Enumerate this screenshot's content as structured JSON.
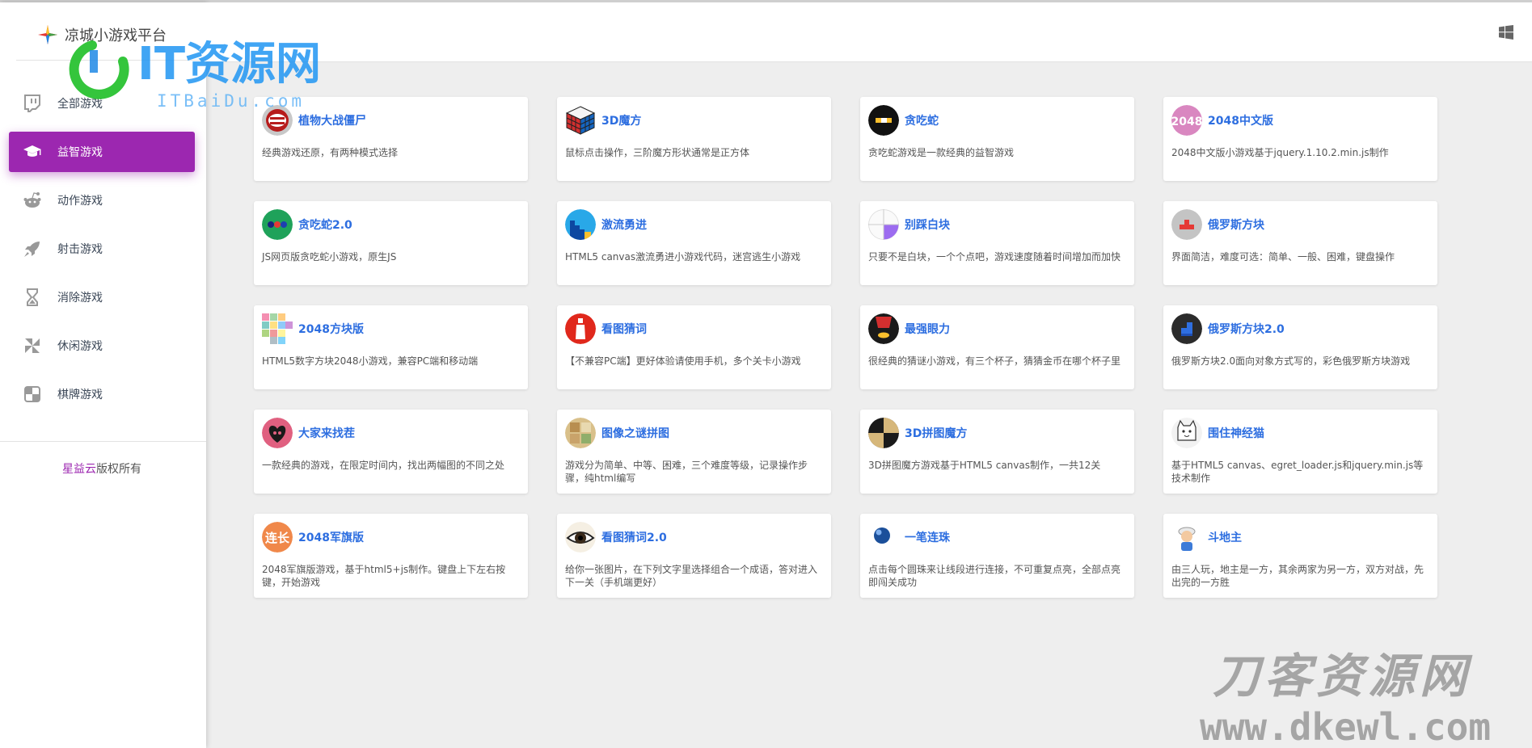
{
  "brand": {
    "title": "凉城小游戏平台"
  },
  "sidebar": {
    "items": [
      {
        "label": "全部游戏",
        "icon": "twitch-icon"
      },
      {
        "label": "益智游戏",
        "icon": "graduation-cap-icon",
        "active": true
      },
      {
        "label": "动作游戏",
        "icon": "reddit-icon"
      },
      {
        "label": "射击游戏",
        "icon": "rocket-icon"
      },
      {
        "label": "消除游戏",
        "icon": "hourglass-icon"
      },
      {
        "label": "休闲游戏",
        "icon": "pinwheel-icon"
      },
      {
        "label": "棋牌游戏",
        "icon": "checker-icon"
      }
    ],
    "copyright_link": "星益云",
    "copyright_text": "版权所有"
  },
  "header": {
    "icon": "windows-icon"
  },
  "colors": {
    "accent": "#9c27b0",
    "title_link": "#2d6ee0",
    "background": "#eeeeee"
  },
  "games": [
    {
      "title": "植物大战僵尸",
      "desc": "经典游戏还原，有两种模式选择",
      "thumb": "popcap"
    },
    {
      "title": "3D魔方",
      "desc": "鼠标点击操作，三阶魔方形状通常是正方体",
      "thumb": "cube"
    },
    {
      "title": "贪吃蛇",
      "desc": "贪吃蛇游戏是一款经典的益智游戏",
      "thumb": "snake"
    },
    {
      "title": "2048中文版",
      "desc": "2048中文版小游戏基于jquery.1.10.2.min.js制作",
      "thumb": "t2048",
      "thumb_text": "2048"
    },
    {
      "title": "贪吃蛇2.0",
      "desc": "JS网页版贪吃蛇小游戏，原生JS",
      "thumb": "snake2"
    },
    {
      "title": "激流勇进",
      "desc": "HTML5 canvas激流勇进小游戏代码，迷宫逃生小游戏",
      "thumb": "rapids"
    },
    {
      "title": "别踩白块",
      "desc": "只要不是白块，一个个点吧，游戏速度随着时间增加而加快",
      "thumb": "tiles"
    },
    {
      "title": "俄罗斯方块",
      "desc": "界面简洁，难度可选：简单、一般、困难，键盘操作",
      "thumb": "tetris"
    },
    {
      "title": "2048方块版",
      "desc": "HTML5数字方块2048小游戏，兼容PC端和移动端",
      "thumb": "blocks"
    },
    {
      "title": "看图猜词",
      "desc": "【不兼容PC端】更好体验请使用手机，多个关卡小游戏",
      "thumb": "guess"
    },
    {
      "title": "最强眼力",
      "desc": "很经典的猜谜小游戏，有三个杯子，猜猜金币在哪个杯子里",
      "thumb": "cups"
    },
    {
      "title": "俄罗斯方块2.0",
      "desc": "俄罗斯方块2.0面向对象方式写的，彩色俄罗斯方块游戏",
      "thumb": "tetris2"
    },
    {
      "title": "大家来找茬",
      "desc": "一款经典的游戏，在限定时间内，找出两幅图的不同之处",
      "thumb": "heart"
    },
    {
      "title": "图像之谜拼图",
      "desc": "游戏分为简单、中等、困难，三个难度等级，记录操作步骤，纯html编写",
      "thumb": "puzzle"
    },
    {
      "title": "3D拼图魔方",
      "desc": "3D拼图魔方游戏基于HTML5 canvas制作，一共12关",
      "thumb": "puzzle3d"
    },
    {
      "title": "围住神经猫",
      "desc": "基于HTML5 canvas、egret_loader.js和jquery.min.js等技术制作",
      "thumb": "cat"
    },
    {
      "title": "2048军旗版",
      "desc": "2048军旗版游戏，基于html5+js制作。键盘上下左右按键，开始游戏",
      "thumb": "army",
      "thumb_text": "连长"
    },
    {
      "title": "看图猜词2.0",
      "desc": "给你一张图片，在下列文字里选择组合一个成语，答对进入下一关（手机端更好）",
      "thumb": "eye"
    },
    {
      "title": "一笔连珠",
      "desc": "点击每个圆珠来让线段进行连接，不可重复点亮，全部点亮即闯关成功",
      "thumb": "ball"
    },
    {
      "title": "斗地主",
      "desc": "由三人玩，地主是一方，其余两家为另一方，双方对战，先出完的一方胜",
      "thumb": "landlord"
    }
  ],
  "watermarks": {
    "top_brand": "IT资源网",
    "top_url": "ITBaiDu.com",
    "bottom_brand": "刀客资源网",
    "bottom_url": "www.dkewl.com"
  }
}
